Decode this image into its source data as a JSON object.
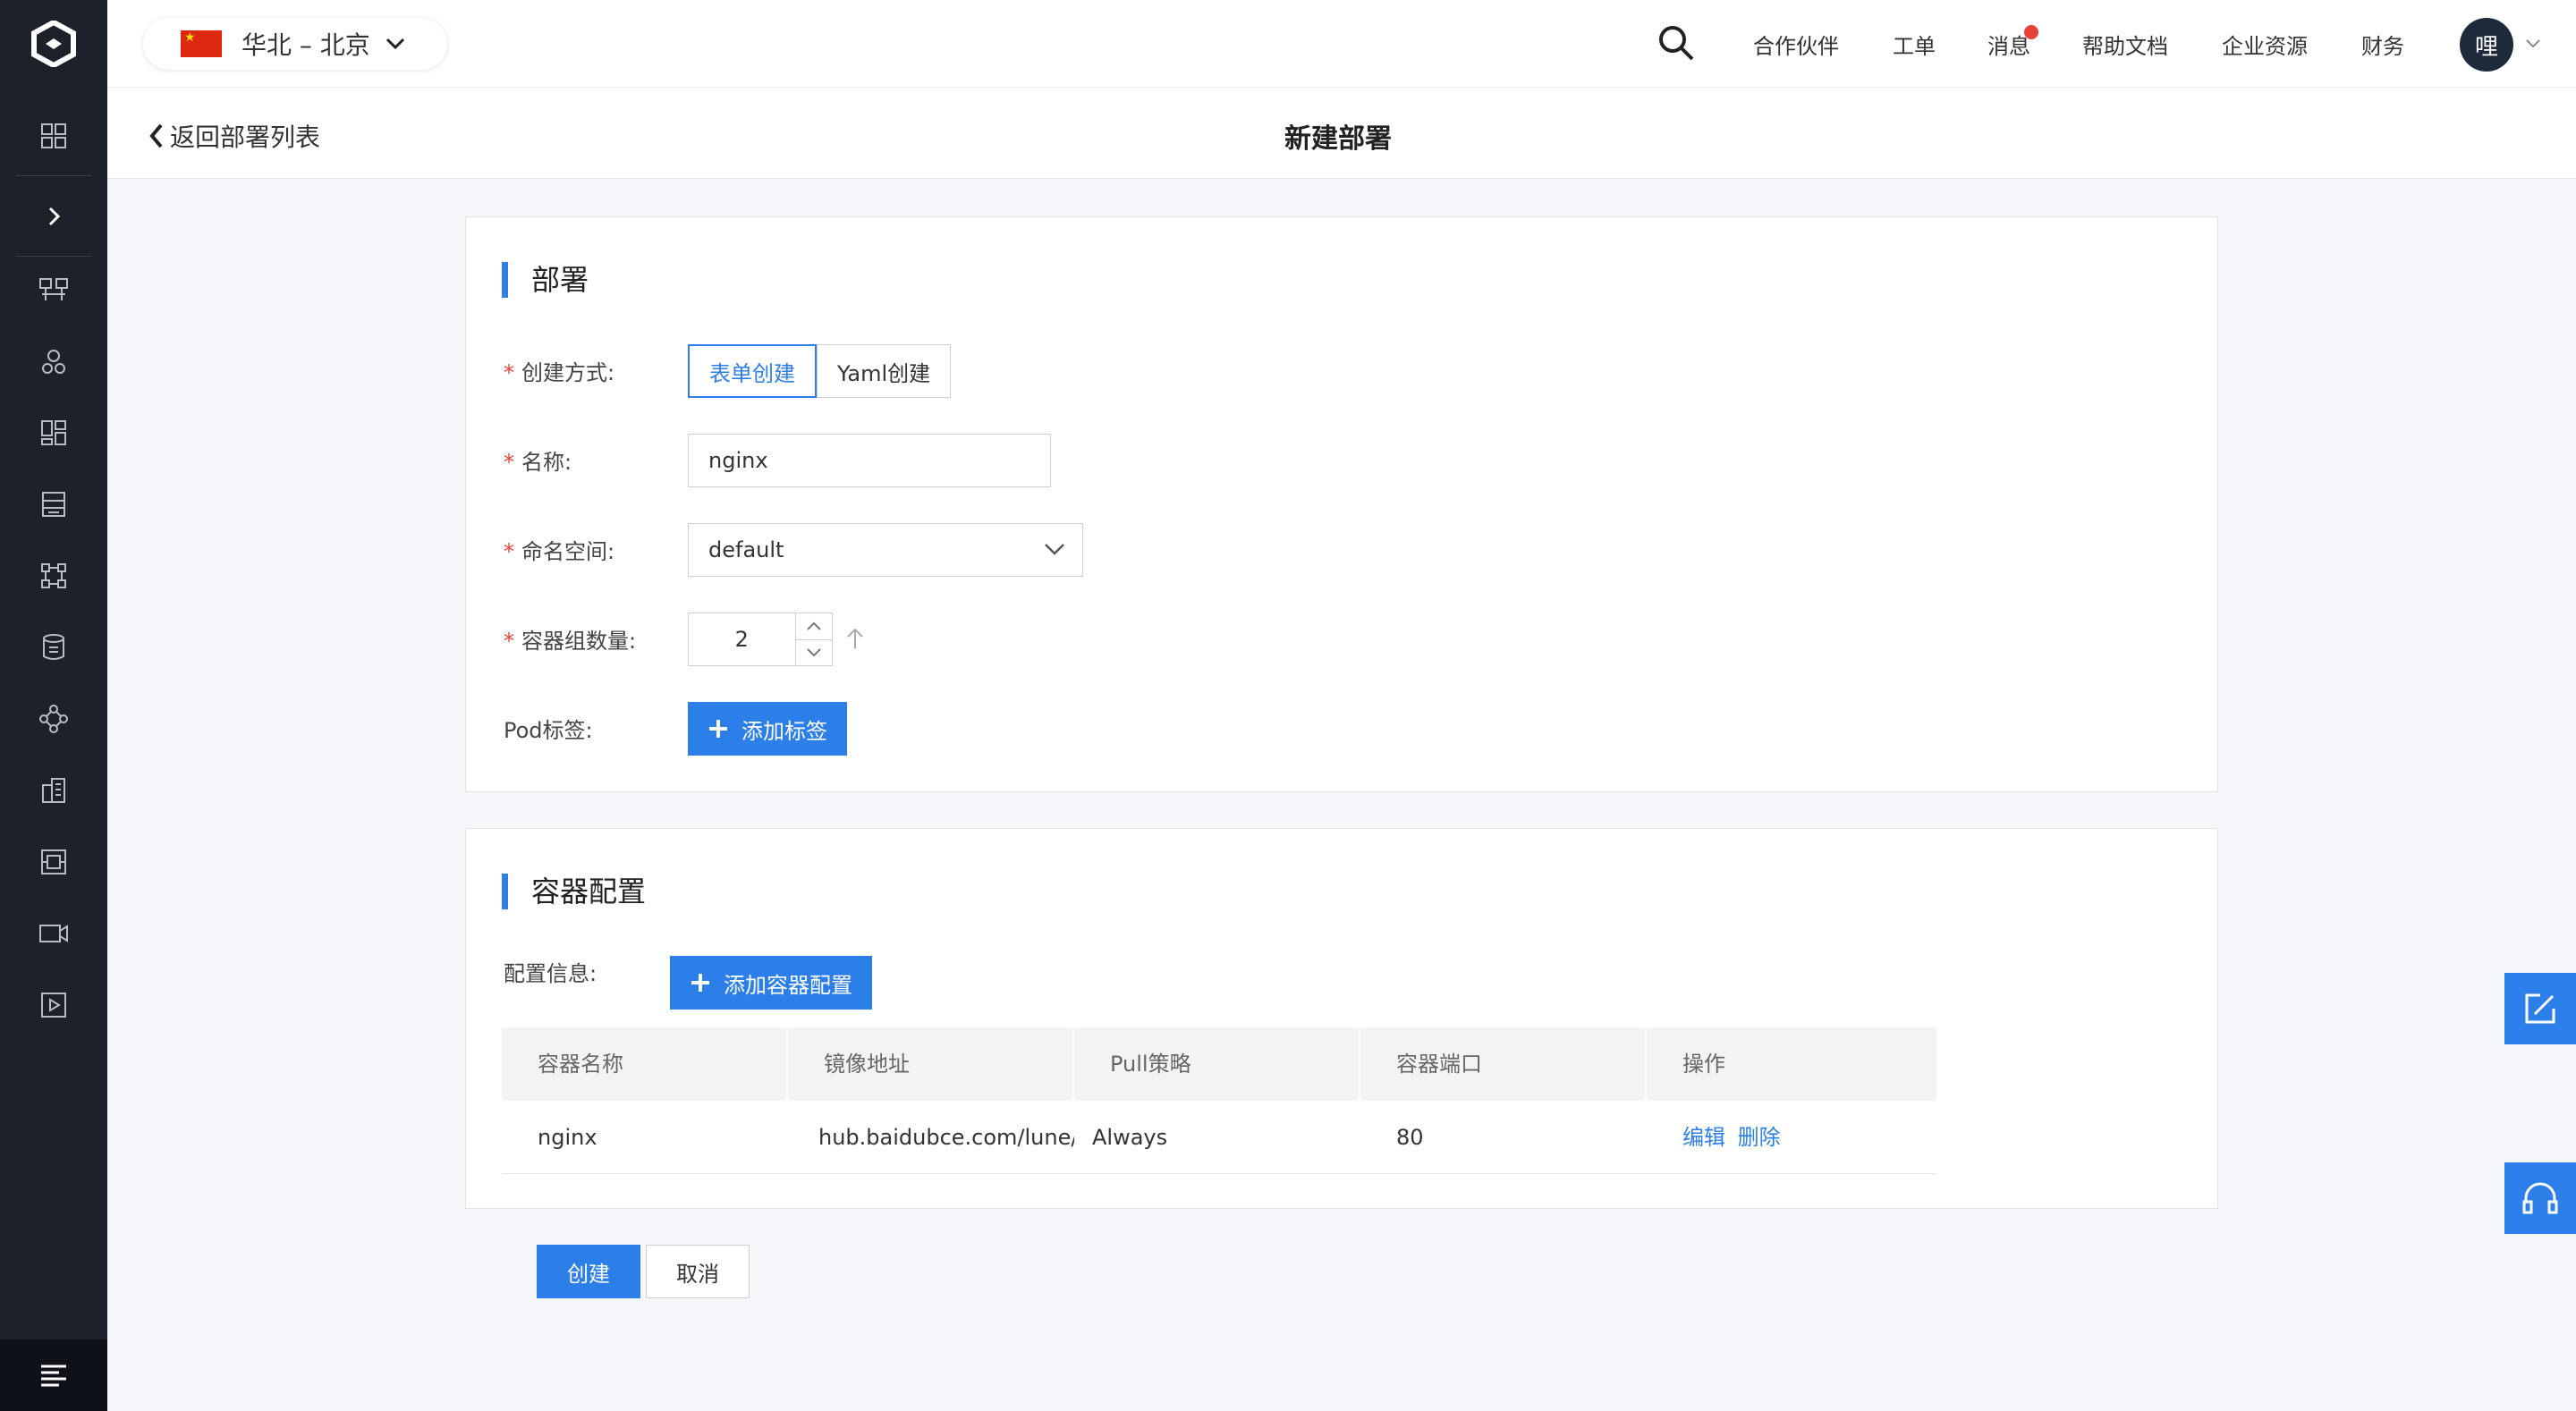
{
  "topbar": {
    "region": "华北 – 北京",
    "links": [
      "合作伙伴",
      "工单",
      "消息",
      "帮助文档",
      "企业资源",
      "财务"
    ],
    "avatar": "哩"
  },
  "header": {
    "back": "返回部署列表",
    "title": "新建部署"
  },
  "deploy": {
    "section_title": "部署",
    "create_mode_label": "创建方式:",
    "create_mode_options": [
      "表单创建",
      "Yaml创建"
    ],
    "name_label": "名称:",
    "name_value": "nginx",
    "namespace_label": "命名空间:",
    "namespace_value": "default",
    "replicas_label": "容器组数量:",
    "replicas_value": "2",
    "pod_label": "Pod标签:",
    "add_label_button": "添加标签"
  },
  "container": {
    "section_title": "容器配置",
    "config_label": "配置信息:",
    "add_config_button": "添加容器配置",
    "columns": [
      "容器名称",
      "镜像地址",
      "Pull策略",
      "容器端口",
      "操作"
    ],
    "rows": [
      {
        "name": "nginx",
        "image": "hub.baidubce.com/lune/ng",
        "pull": "Always",
        "port": "80",
        "edit": "编辑",
        "delete": "删除"
      }
    ]
  },
  "actions": {
    "create": "创建",
    "cancel": "取消"
  },
  "colors": {
    "accent": "#2c7fe8",
    "sidebar": "#1d2129",
    "required": "#ea4335"
  }
}
